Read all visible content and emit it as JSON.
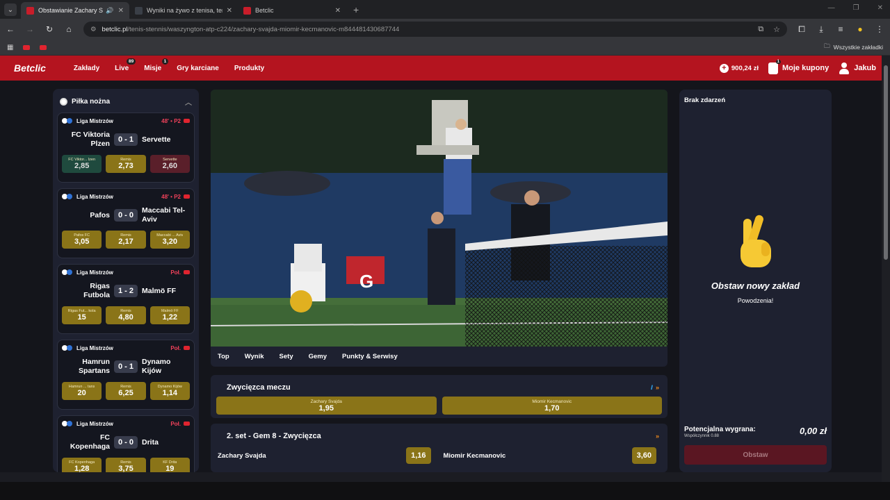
{
  "browser": {
    "tabs": [
      {
        "title": "Obstawianie Zachary Svajda",
        "active": true,
        "favicon": "#c81d2a"
      },
      {
        "title": "Wyniki na żywo z tenisa, tenis li",
        "active": false,
        "favicon": "#3a3f47"
      },
      {
        "title": "Betclic",
        "active": false,
        "favicon": "#c81d2a"
      }
    ],
    "url_host": "betclic.pl",
    "url_path": "/tenis-stennis/waszyngton-atp-c224/zachary-svajda-miomir-kecmanovic-m844481430687744",
    "bookmarks_all": "Wszystkie zakładki"
  },
  "nav": {
    "logo": "Betclic",
    "items": [
      "Zakłady",
      "Live",
      "Misje",
      "Gry karciane",
      "Produkty"
    ],
    "live_badge": "89",
    "misje_badge": "1",
    "balance": "900,24 zł",
    "coupons_label": "Moje kupony",
    "coupons_badge": "1",
    "user": "Jakub"
  },
  "sidebar": {
    "sport": "Piłka nożna",
    "matches": [
      {
        "league": "Liga Mistrzów",
        "time": "48' • P2",
        "home": "FC Viktoria Plzen",
        "away": "Servette",
        "score": "0 - 1",
        "odds": [
          {
            "label": "FC Viktor... lzen",
            "value": "2,85",
            "state": "up"
          },
          {
            "label": "Remis",
            "value": "2,73",
            "state": ""
          },
          {
            "label": "Servette",
            "value": "2,60",
            "state": "down"
          }
        ]
      },
      {
        "league": "Liga Mistrzów",
        "time": "48' • P2",
        "home": "Pafos",
        "away": "Maccabi Tel-Aviv",
        "score": "0 - 0",
        "odds": [
          {
            "label": "Pafos FC",
            "value": "3,05",
            "state": ""
          },
          {
            "label": "Remis",
            "value": "2,17",
            "state": ""
          },
          {
            "label": "Maccabi ... Aviv",
            "value": "3,20",
            "state": ""
          }
        ]
      },
      {
        "league": "Liga Mistrzów",
        "time": "Poł.",
        "home": "Rigas Futbola",
        "away": "Malmö FF",
        "score": "1 - 2",
        "odds": [
          {
            "label": "Rigas Fut... kola",
            "value": "15",
            "state": ""
          },
          {
            "label": "Remis",
            "value": "4,80",
            "state": ""
          },
          {
            "label": "Malmö FF",
            "value": "1,22",
            "state": ""
          }
        ]
      },
      {
        "league": "Liga Mistrzów",
        "time": "Poł.",
        "home": "Hamrun Spartans",
        "away": "Dynamo Kijów",
        "score": "0 - 1",
        "odds": [
          {
            "label": "Hamrun ... tans",
            "value": "20",
            "state": ""
          },
          {
            "label": "Remis",
            "value": "6,25",
            "state": ""
          },
          {
            "label": "Dynamo Kijów",
            "value": "1,14",
            "state": ""
          }
        ]
      },
      {
        "league": "Liga Mistrzów",
        "time": "Poł.",
        "home": "FC Kopenhaga",
        "away": "Drita",
        "score": "0 - 0",
        "odds": [
          {
            "label": "FC Kopenhaga",
            "value": "1,28",
            "state": ""
          },
          {
            "label": "Remis",
            "value": "3,75",
            "state": ""
          },
          {
            "label": "KF Drita",
            "value": "19",
            "state": ""
          }
        ]
      }
    ]
  },
  "video_tabs": [
    "Top",
    "Wynik",
    "Sety",
    "Gemy",
    "Punkty & Serwisy"
  ],
  "market1": {
    "title": "Zwycięzca meczu",
    "odds": [
      {
        "label": "Zachary Svajda",
        "value": "1,95"
      },
      {
        "label": "Miomir Kecmanovic",
        "value": "1,70"
      }
    ]
  },
  "market2": {
    "title": "2. set - Gem 8 - Zwycięzca",
    "rows": [
      {
        "player": "Zachary Svajda",
        "value": "1,16"
      },
      {
        "player": "Miomir Kecmanovic",
        "value": "3,60"
      }
    ]
  },
  "betslip": {
    "header": "Brak zdarzeń",
    "title": "Obstaw nowy zakład",
    "subtitle": "Powodzenia!",
    "potential_label": "Potencjalna wygrana:",
    "coef_label": "Współczynnik 0.88",
    "potential_value": "0,00 zł",
    "button": "Obstaw"
  }
}
